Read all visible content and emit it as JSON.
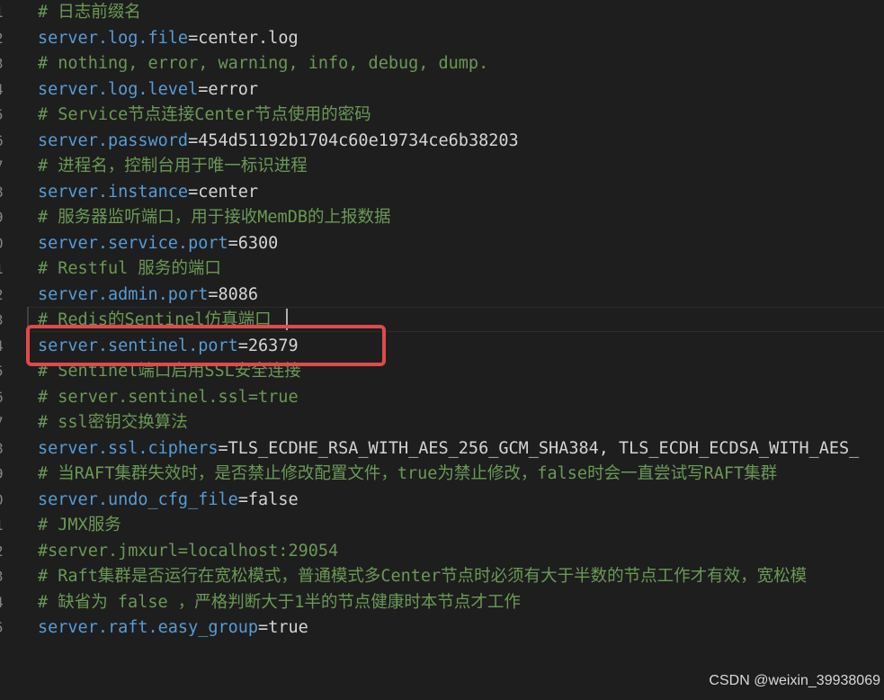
{
  "editor": {
    "colors": {
      "background": "#1e1e1e",
      "key": "#569cd6",
      "value": "#d4d4d4",
      "comment": "#6a9955",
      "highlight_box": "#e04a4a"
    },
    "line_numbers": [
      "1",
      "2",
      "3",
      "4",
      "5",
      "6",
      "7",
      "8",
      "9",
      "0",
      "1",
      "2",
      "3",
      "4",
      "5",
      "6",
      "7",
      "8",
      "9",
      "0",
      "1",
      "2",
      "3",
      "4",
      "5"
    ],
    "lines": [
      {
        "type": "comment",
        "text": "# 日志前缀名"
      },
      {
        "type": "kv",
        "key": "server.log.file",
        "value": "center.log"
      },
      {
        "type": "comment",
        "text": "# nothing, error, warning, info, debug, dump."
      },
      {
        "type": "kv",
        "key": "server.log.level",
        "value": "error"
      },
      {
        "type": "comment",
        "text": "# Service节点连接Center节点使用的密码"
      },
      {
        "type": "kv",
        "key": "server.password",
        "value": "454d51192b1704c60e19734ce6b38203"
      },
      {
        "type": "comment",
        "text": "# 进程名，控制台用于唯一标识进程"
      },
      {
        "type": "kv",
        "key": "server.instance",
        "value": "center"
      },
      {
        "type": "comment",
        "text": "# 服务器监听端口，用于接收MemDB的上报数据"
      },
      {
        "type": "kv",
        "key": "server.service.port",
        "value": "6300"
      },
      {
        "type": "comment",
        "text": "# Restful 服务的端口"
      },
      {
        "type": "kv",
        "key": "server.admin.port",
        "value": "8086"
      },
      {
        "type": "comment",
        "text": "# Redis的Sentinel仿真端口"
      },
      {
        "type": "kv",
        "key": "server.sentinel.port",
        "value": "26379"
      },
      {
        "type": "comment",
        "text": "# Sentinel端口启用SSL安全连接"
      },
      {
        "type": "comment",
        "text": "# server.sentinel.ssl=true"
      },
      {
        "type": "comment",
        "text": "# ssl密钥交换算法"
      },
      {
        "type": "kv",
        "key": "server.ssl.ciphers",
        "value": "TLS_ECDHE_RSA_WITH_AES_256_GCM_SHA384, TLS_ECDH_ECDSA_WITH_AES_"
      },
      {
        "type": "comment",
        "text": "# 当RAFT集群失效时，是否禁止修改配置文件，true为禁止修改，false时会一直尝试写RAFT集群"
      },
      {
        "type": "kv",
        "key": "server.undo_cfg_file",
        "value": "false"
      },
      {
        "type": "comment",
        "text": "# JMX服务"
      },
      {
        "type": "comment",
        "text": "#server.jmxurl=localhost:29054"
      },
      {
        "type": "comment",
        "text": "# Raft集群是否运行在宽松模式，普通模式多Center节点时必须有大于半数的节点工作才有效，宽松模"
      },
      {
        "type": "comment",
        "text": "# 缺省为 false ，严格判断大于1半的节点健康时本节点才工作"
      },
      {
        "type": "kv",
        "key": "server.raft.easy_group",
        "value": "true"
      }
    ]
  },
  "watermark": "CSDN @weixin_39938069"
}
